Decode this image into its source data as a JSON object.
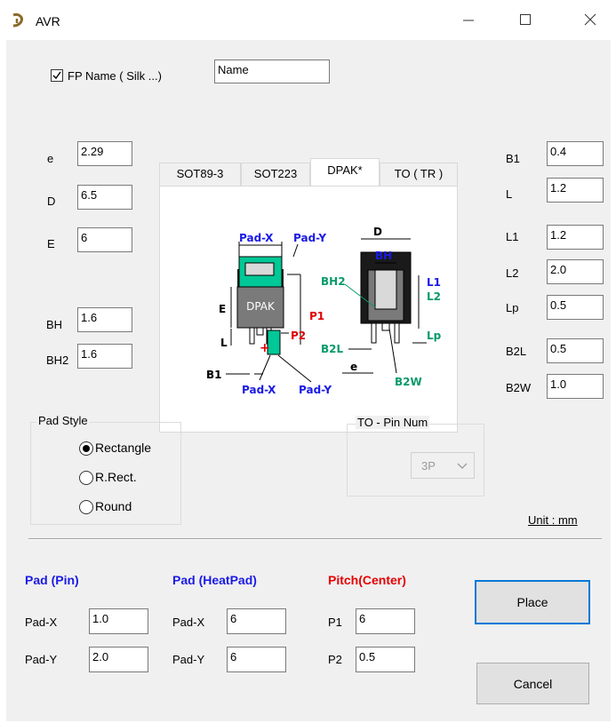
{
  "window": {
    "title": "AVR"
  },
  "fp_name": {
    "checkbox_label": "FP Name ( Silk ...)",
    "checked": true,
    "value": "Name"
  },
  "tabs": [
    {
      "label": "SOT89-3",
      "active": false
    },
    {
      "label": "SOT223",
      "active": false
    },
    {
      "label": "DPAK*",
      "active": true
    },
    {
      "label": "TO ( TR )",
      "active": false
    }
  ],
  "left_params": [
    {
      "label": "e",
      "value": "2.29"
    },
    {
      "label": "D",
      "value": "6.5"
    },
    {
      "label": "E",
      "value": "6"
    },
    {
      "label": "BH",
      "value": "1.6"
    },
    {
      "label": "BH2",
      "value": "1.6"
    }
  ],
  "right_params": [
    {
      "label": "B1",
      "value": "0.4"
    },
    {
      "label": "L",
      "value": "1.2"
    },
    {
      "label": "L1",
      "value": "1.2"
    },
    {
      "label": "L2",
      "value": "2.0"
    },
    {
      "label": "Lp",
      "value": "0.5"
    },
    {
      "label": "B2L",
      "value": "0.5"
    },
    {
      "label": "B2W",
      "value": "1.0"
    }
  ],
  "diagram": {
    "pad_x_top": "Pad-X",
    "pad_y_top": "Pad-Y",
    "pad_x_bottom": "Pad-X",
    "pad_y_bottom": "Pad-Y",
    "package": "DPAK",
    "E": "E",
    "L": "L",
    "B1": "B1",
    "P1": "P1",
    "P2": "P2",
    "D": "D",
    "BH": "BH",
    "BH2": "BH2",
    "L1": "L1",
    "L2": "L2",
    "Lp": "Lp",
    "B2L": "B2L",
    "e": "e",
    "B2W": "B2W"
  },
  "pad_style": {
    "title": "Pad Style",
    "options": [
      {
        "label": "Rectangle",
        "selected": true
      },
      {
        "label": "R.Rect.",
        "selected": false
      },
      {
        "label": "Round",
        "selected": false
      }
    ]
  },
  "to_pin": {
    "title": "TO - Pin Num",
    "value": "3P"
  },
  "unit": "Unit : mm",
  "pad_pin": {
    "title": "Pad (Pin)",
    "x_label": "Pad-X",
    "x_value": "1.0",
    "y_label": "Pad-Y",
    "y_value": "2.0"
  },
  "pad_heat": {
    "title": "Pad (HeatPad)",
    "x_label": "Pad-X",
    "x_value": "6",
    "y_label": "Pad-Y",
    "y_value": "6"
  },
  "pitch": {
    "title": "Pitch(Center)",
    "p1_label": "P1",
    "p1_value": "6",
    "p2_label": "P2",
    "p2_value": "0.5"
  },
  "buttons": {
    "place": "Place",
    "cancel": "Cancel"
  },
  "colors": {
    "blue": "#1a1ae6",
    "red": "#e60000",
    "green": "#0a9a6a",
    "accent": "#0078d7"
  }
}
